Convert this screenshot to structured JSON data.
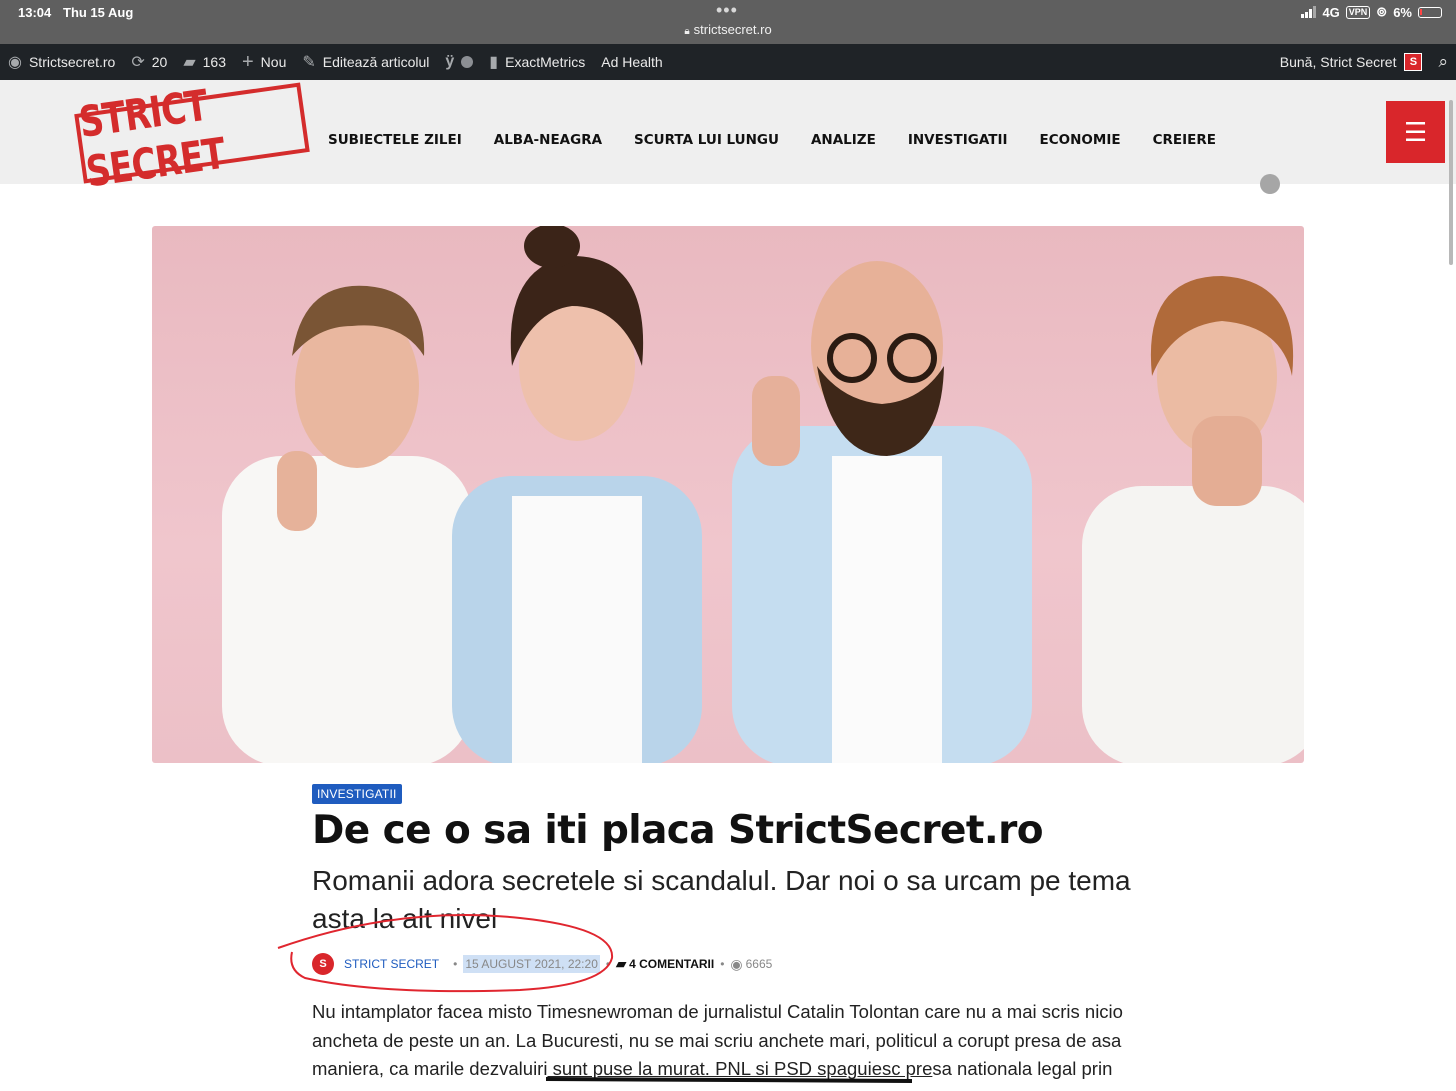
{
  "status_bar": {
    "time": "13:04",
    "date": "Thu 15 Aug",
    "url": "strictsecret.ro",
    "network": "4G",
    "vpn": "VPN",
    "battery": "6%"
  },
  "admin_bar": {
    "site": "Strictsecret.ro",
    "updates": "20",
    "comments": "163",
    "new_label": "Nou",
    "edit_label": "Editează articolul",
    "exactmetrics": "ExactMetrics",
    "ad_health": "Ad Health",
    "greeting": "Bună, Strict Secret",
    "avatar_letter": "S"
  },
  "header": {
    "logo_text": "STRICT SECRET",
    "nav": [
      "SUBIECTELE ZILEI",
      "ALBA-NEAGRA",
      "SCURTA LUI LUNGU",
      "ANALIZE",
      "INVESTIGATII",
      "ECONOMIE",
      "CREIERE"
    ],
    "menu_icon": "hamburger-icon"
  },
  "article": {
    "category": "INVESTIGATII",
    "title": "De ce o sa iti placa StrictSecret.ro",
    "subtitle": "Romanii adora secretele si scandalul. Dar noi o sa urcam pe tema asta la alt nivel",
    "author": "STRICT SECRET",
    "date": "15 AUGUST 2021, 22:20",
    "comments": "4 COMENTARII",
    "views": "6665",
    "body_part1": "Nu intamplator facea misto Timesnewroman de jurnalistul Catalin Tolontan care nu a mai scris nicio ancheta de peste un an. La Bucuresti, nu se mai scriu anchete mari, politicul a corupt presa de asa maniera, ca marile dezvaluiri",
    "body_underlined": " sunt puse la murat. PNL si PSD spaguiesc pre",
    "body_part2": "sa nationala legal prin"
  },
  "colors": {
    "brand_red": "#d9262b",
    "link_blue": "#1f5cbf",
    "admin_bar": "#1f2327",
    "hero_bg": "#eebfc6"
  }
}
